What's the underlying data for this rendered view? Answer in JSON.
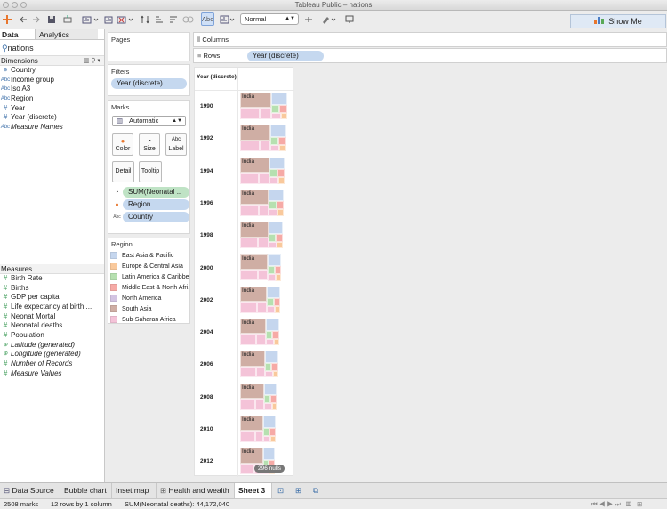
{
  "window": {
    "title": "Tableau Public – nations"
  },
  "toolbar": {
    "view_size": "Normal",
    "show_me": "Show Me",
    "label_toggle": "Abc"
  },
  "left_panel": {
    "tabs": [
      {
        "label": "Data"
      },
      {
        "label": "Analytics"
      }
    ],
    "datasource": "nations",
    "dimensions_header": "Dimensions",
    "dimensions": [
      {
        "label": "Country",
        "icon": "globe-icon"
      },
      {
        "label": "Income group",
        "icon": "abc-icon"
      },
      {
        "label": "Iso A3",
        "icon": "abc-icon"
      },
      {
        "label": "Region",
        "icon": "abc-icon"
      },
      {
        "label": "Year",
        "icon": "hash-icon"
      },
      {
        "label": "Year (discrete)",
        "icon": "hash-icon"
      },
      {
        "label": "Measure Names",
        "icon": "abc-icon"
      }
    ],
    "measures_header": "Measures",
    "measures": [
      {
        "label": "Birth Rate",
        "icon": "hash-icon"
      },
      {
        "label": "Births",
        "icon": "hash-icon"
      },
      {
        "label": "GDP per capita",
        "icon": "hash-icon"
      },
      {
        "label": "Life expectancy at birth ...",
        "icon": "hash-icon"
      },
      {
        "label": "Neonat Mortal",
        "icon": "hash-icon"
      },
      {
        "label": "Neonatal deaths",
        "icon": "hash-icon"
      },
      {
        "label": "Population",
        "icon": "hash-icon"
      },
      {
        "label": "Latitude (generated)",
        "icon": "globe-icon"
      },
      {
        "label": "Longitude (generated)",
        "icon": "globe-icon"
      },
      {
        "label": "Number of Records",
        "icon": "hash-icon"
      },
      {
        "label": "Measure Values",
        "icon": "hash-icon"
      }
    ]
  },
  "cards": {
    "pages": "Pages",
    "filters": "Filters",
    "filter_pill": "Year (discrete)",
    "marks": "Marks",
    "mark_type": "Automatic",
    "color": "Color",
    "size": "Size",
    "label": "Label",
    "detail": "Detail",
    "tooltip": "Tooltip",
    "mark_fields": [
      {
        "label": "SUM(Neonatal ..",
        "kind": "size"
      },
      {
        "label": "Region",
        "kind": "color"
      },
      {
        "label": "Country",
        "kind": "label"
      }
    ],
    "legend_title": "Region",
    "legend": [
      {
        "label": "East Asia & Pacific",
        "color": "#c5d6ee"
      },
      {
        "label": "Europe & Central Asia",
        "color": "#f9c99c"
      },
      {
        "label": "Latin America & Caribbe..",
        "color": "#b6e0b0"
      },
      {
        "label": "Middle East & North Afri..",
        "color": "#f6aaa6"
      },
      {
        "label": "North America",
        "color": "#d3c4e2"
      },
      {
        "label": "South Asia",
        "color": "#cfaea4"
      },
      {
        "label": "Sub-Saharan Africa",
        "color": "#f4c3d8"
      }
    ]
  },
  "shelves": {
    "columns": "Columns",
    "rows": "Rows",
    "rows_pill": "Year (discrete)"
  },
  "chart_data": {
    "type": "table",
    "header": "Year (discrete)",
    "rows": [
      "1990",
      "1992",
      "1994",
      "1996",
      "1998",
      "2000",
      "2002",
      "2004",
      "2006",
      "2008",
      "2010",
      "2012"
    ],
    "label": "India",
    "nulls_badge": "296 nulls"
  },
  "bottom_tabs": [
    {
      "label": "Data Source"
    },
    {
      "label": "Bubble chart"
    },
    {
      "label": "Inset map"
    },
    {
      "label": "Health and wealth"
    },
    {
      "label": "Sheet 3"
    }
  ],
  "status": {
    "marks": "2508 marks",
    "dims": "12 rows by 1 column",
    "sum": "SUM(Neonatal deaths): 44,172,040"
  }
}
